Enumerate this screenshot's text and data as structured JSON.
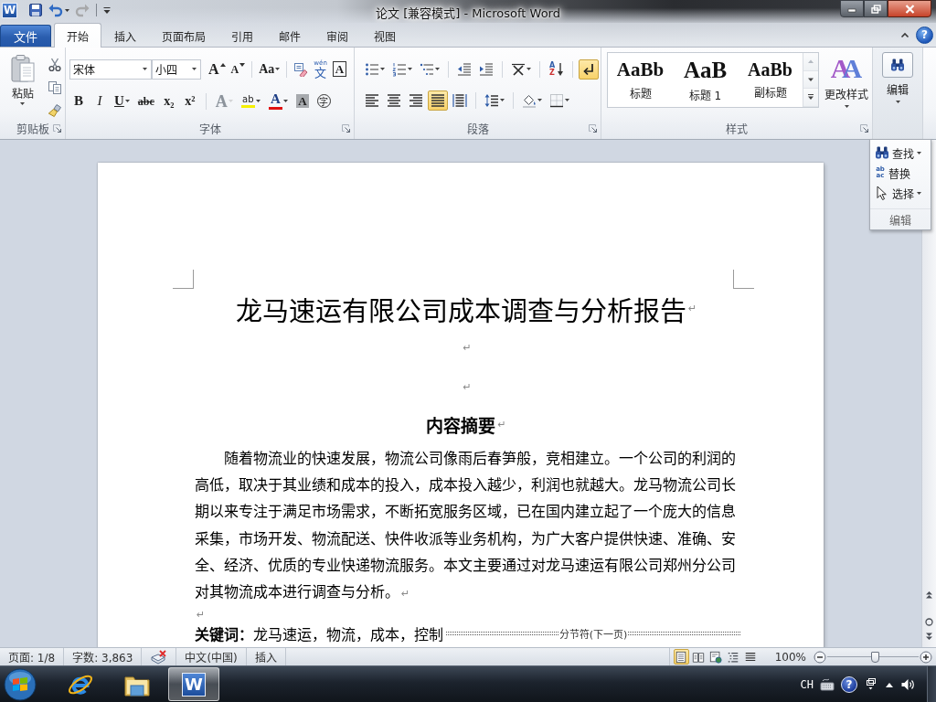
{
  "window": {
    "app_logo": "W",
    "title": "论文 [兼容模式] - Microsoft Word"
  },
  "quick_access": [
    {
      "kind": "save",
      "dropdown": false,
      "disabled": false
    },
    {
      "kind": "undo",
      "dropdown": true,
      "disabled": false
    },
    {
      "kind": "redo",
      "dropdown": false,
      "disabled": true
    }
  ],
  "file_tab": "文件",
  "tabs": [
    {
      "label": "开始",
      "selected": true
    },
    {
      "label": "插入",
      "selected": false
    },
    {
      "label": "页面布局",
      "selected": false
    },
    {
      "label": "引用",
      "selected": false
    },
    {
      "label": "邮件",
      "selected": false
    },
    {
      "label": "审阅",
      "selected": false
    },
    {
      "label": "视图",
      "selected": false
    }
  ],
  "help_button": "?",
  "ribbon": {
    "clipboard": {
      "label": "剪贴板",
      "paste": "粘贴"
    },
    "font": {
      "label": "字体",
      "font_name": "宋体",
      "font_size": "小四",
      "row_1": [
        [
          {
            "kind": "grow",
            "glyph": "A",
            "dropdown": false,
            "disabled": false
          },
          {
            "kind": "shrink",
            "glyph": "A",
            "dropdown": false,
            "disabled": false
          }
        ],
        [
          {
            "kind": "change_case",
            "glyph": "Aa",
            "dropdown": true,
            "disabled": false
          }
        ],
        [
          {
            "kind": "clear_formatting",
            "dropdown": false,
            "disabled": false
          },
          {
            "kind": "phonetic",
            "glyph": "文",
            "ruby": "wén",
            "dropdown": false,
            "disabled": false
          },
          {
            "kind": "char_border",
            "glyph": "A",
            "dropdown": false,
            "disabled": false
          }
        ]
      ],
      "row_2": [
        [
          {
            "kind": "bold",
            "glyph": "B",
            "dropdown": false,
            "disabled": false
          },
          {
            "kind": "italic",
            "glyph": "I",
            "dropdown": false,
            "disabled": false
          },
          {
            "kind": "underline",
            "glyph": "U",
            "dropdown": true,
            "disabled": false
          },
          {
            "kind": "strikethrough",
            "glyph": "abc",
            "dropdown": false,
            "disabled": false
          },
          {
            "kind": "subscript",
            "glyph": "x₂",
            "dropdown": false,
            "disabled": false
          },
          {
            "kind": "superscript",
            "glyph": "x²",
            "dropdown": false,
            "disabled": false
          }
        ],
        [
          {
            "kind": "text_effects",
            "glyph": "A",
            "dropdown": true,
            "disabled": true
          },
          {
            "kind": "highlight",
            "glyph": "ab",
            "color": "#f5f000",
            "dropdown": true,
            "disabled": false
          },
          {
            "kind": "font_color",
            "glyph": "A",
            "color": "#e01010",
            "dropdown": true,
            "disabled": false
          },
          {
            "kind": "char_shading",
            "glyph": "A",
            "dropdown": false,
            "disabled": false
          },
          {
            "kind": "enclose",
            "glyph": "字",
            "dropdown": false,
            "disabled": false
          }
        ]
      ]
    },
    "paragraph": {
      "label": "段落",
      "row_1": [
        [
          {
            "kind": "bullets",
            "dropdown": true,
            "on": false
          },
          {
            "kind": "numbering",
            "dropdown": true,
            "on": false
          },
          {
            "kind": "multilevel",
            "dropdown": true,
            "on": false
          }
        ],
        [
          {
            "kind": "decrease_indent",
            "dropdown": false,
            "on": false
          },
          {
            "kind": "increase_indent",
            "dropdown": false,
            "on": false
          }
        ],
        [
          {
            "kind": "asian_layout",
            "dropdown": true,
            "on": false
          }
        ],
        [
          {
            "kind": "sort",
            "glyph": "A Z",
            "dropdown": false,
            "on": false
          }
        ],
        [
          {
            "kind": "show_marks",
            "dropdown": false,
            "on": true
          }
        ]
      ],
      "row_2": [
        [
          {
            "kind": "align_left",
            "dropdown": false,
            "on": false
          },
          {
            "kind": "align_center",
            "dropdown": false,
            "on": false
          },
          {
            "kind": "align_right",
            "dropdown": false,
            "on": false
          },
          {
            "kind": "justify",
            "dropdown": false,
            "on": true
          },
          {
            "kind": "distributed",
            "dropdown": false,
            "on": false
          }
        ],
        [
          {
            "kind": "line_spacing",
            "dropdown": true,
            "on": false
          }
        ],
        [
          {
            "kind": "shading",
            "dropdown": true,
            "on": false
          },
          {
            "kind": "borders",
            "dropdown": true,
            "on": false
          }
        ]
      ]
    },
    "styles": {
      "label": "样式",
      "gallery": [
        {
          "kind": "title",
          "preview": "AaBb",
          "name": "标题"
        },
        {
          "kind": "heading_1",
          "preview": "AaB",
          "name": "标题 1"
        },
        {
          "kind": "subtitle",
          "preview": "AaBb",
          "name": "副标题"
        }
      ],
      "change_styles": {
        "glyph": "AA",
        "label": "更改样式"
      }
    },
    "editing": {
      "label": "编辑",
      "expanded": true,
      "menu": {
        "items": [
          {
            "kind": "find",
            "label": "查找",
            "dropdown": true
          },
          {
            "kind": "replace",
            "glyph": "ab ac",
            "label": "替换",
            "dropdown": false
          },
          {
            "kind": "select",
            "label": "选择",
            "dropdown": true
          }
        ],
        "label": "编辑"
      }
    }
  },
  "document": {
    "paragraphs": [
      {
        "kind": "title",
        "text": "龙马速运有限公司成本调查与分析报告",
        "mark": "↵"
      },
      {
        "kind": "title",
        "mark": "↵"
      },
      {
        "kind": "title",
        "mark": "↵"
      },
      {
        "kind": "heading",
        "text": "内容摘要",
        "mark": "↵"
      },
      {
        "kind": "body",
        "text": "随着物流业的快速发展，物流公司像雨后春笋般，竞相建立。一个公司的利润的高低，取决于其业绩和成本的投入，成本投入越少，利润也就越大。龙马物流公司长期以来专注于满足市场需求，不断拓宽服务区域，已在国内建立起了一个庞大的信息采集，市场开发、物流配送、快件收派等业务机构，为广大客户提供快速、准确、安全、经济、优质的专业快递物流服务。本文主要通过对龙马速运有限公司郑州分公司对其物流成本进行调查与分析。",
        "mark": "↵"
      },
      {
        "kind": "normal",
        "mark": "↵"
      },
      {
        "kind": "normal",
        "text": "**关键词：**龙马速运，物流，成本，控制",
        "section_break": "分节符(下一页)"
      }
    ]
  },
  "status_bar": {
    "items": [
      {
        "kind": "text",
        "text": "页面: 1/8"
      },
      {
        "kind": "text",
        "text": "字数: 3,863"
      },
      {
        "kind": "proofing"
      },
      {
        "kind": "text",
        "text": "中文(中国)"
      },
      {
        "kind": "text",
        "text": "插入"
      }
    ],
    "views": [
      {
        "kind": "print_layout",
        "selected": true
      },
      {
        "kind": "full_screen_reading",
        "selected": false
      },
      {
        "kind": "web_layout",
        "selected": false
      },
      {
        "kind": "outline",
        "selected": false
      },
      {
        "kind": "draft",
        "selected": false
      }
    ],
    "zoom": {
      "text": "100%",
      "level": 0.52
    }
  },
  "taskbar": {
    "apps": [
      {
        "kind": "browser",
        "selected": false
      },
      {
        "kind": "file_explorer",
        "selected": false
      },
      {
        "kind": "word",
        "glyph": "W",
        "selected": true
      }
    ],
    "tray": {
      "language": "CH",
      "help": "?"
    }
  }
}
